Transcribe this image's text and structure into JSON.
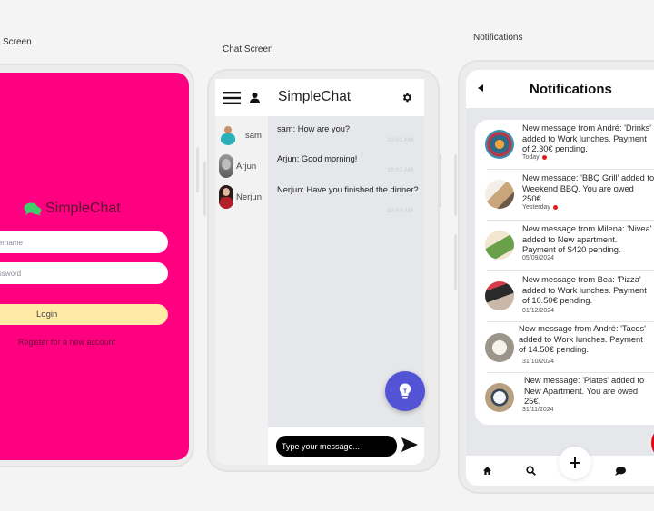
{
  "frames": {
    "login_label": "Screen",
    "chat_label": "Chat Screen",
    "notifications_label": "Notifications"
  },
  "login": {
    "app_name": "SimpleChat",
    "username_placeholder": "Username",
    "password_placeholder": "Password",
    "login_button": "Login",
    "register_link": "Register for a new account",
    "colors": {
      "background": "#ff0080",
      "button": "#ffeaa6",
      "logo_icon": "#3ecf6a"
    }
  },
  "chat": {
    "title": "SimpleChat",
    "icons": {
      "menu": "hamburger-icon",
      "profile": "user-icon",
      "settings": "gear-icon",
      "fab": "lightbulb-icon",
      "send": "send-icon"
    },
    "contacts": [
      {
        "name": "sam"
      },
      {
        "name": "Arjun"
      },
      {
        "name": "Nerjun"
      }
    ],
    "messages": [
      {
        "text": "sam: How are you?",
        "time": "10:01 AM"
      },
      {
        "text": "Arjun: Good morning!",
        "time": "10:02 AM"
      },
      {
        "text": "Nerjun: Have you finished the dinner?",
        "time": "10:03 AM"
      }
    ],
    "input_placeholder": "Type your message...",
    "colors": {
      "fab": "#5353d6"
    }
  },
  "notifications": {
    "title": "Notifications",
    "items": [
      {
        "text": "New message from André: 'Drinks'\nadded to Work lunches. Payment\nof 2.30€ pending.",
        "date": "Today",
        "unread": true
      },
      {
        "text": "New message: 'BBQ Grill' added to\nWeekend BBQ. You are owed\n250€.",
        "date": "Yesterday",
        "unread": true
      },
      {
        "text": "New message from Milena: 'Nivea'\nadded to New apartment.\nPayment of $420 pending.",
        "date": "05/09/2024",
        "unread": false
      },
      {
        "text": "New message from Bea: 'Pizza'\nadded to Work lunches. Payment\nof 10.50€ pending.",
        "date": "01/12/2024",
        "unread": false
      },
      {
        "text": "New message from André: 'Tacos'\nadded to Work lunches. Payment\nof 14.50€ pending.",
        "date": "31/10/2024",
        "unread": false
      },
      {
        "text": "New message: 'Plates' added to\nNew Apartment. You are owed\n25€.",
        "date": "31/11/2024",
        "unread": false
      }
    ],
    "nav": [
      "home-icon",
      "search-icon",
      "plus-icon",
      "chat-bubble-icon"
    ],
    "colors": {
      "unread_dot": "#e21b1b",
      "fab": "#e60012"
    }
  }
}
